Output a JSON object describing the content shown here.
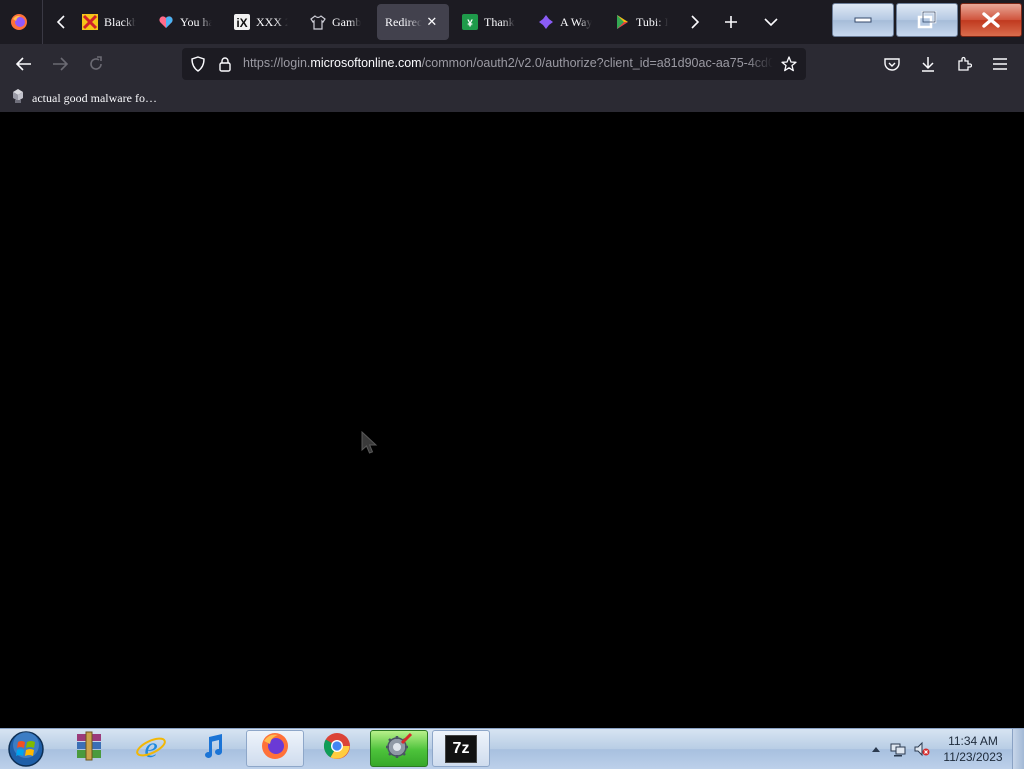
{
  "browser": {
    "tabs": [
      {
        "title": "Blackb",
        "favicon": "x-logo-icon",
        "active": false
      },
      {
        "title": "You ha",
        "favicon": "heart-icon",
        "active": false
      },
      {
        "title": "XXX 2",
        "favicon": "ix-logo-icon",
        "active": false
      },
      {
        "title": "Gamb",
        "favicon": "shirt-icon",
        "active": false
      },
      {
        "title": "Redirec",
        "favicon": "none",
        "active": true
      },
      {
        "title": "Thank",
        "favicon": "green-y-icon",
        "active": false
      },
      {
        "title": "A Way",
        "favicon": "purple-diamond-icon",
        "active": false
      },
      {
        "title": "Tubi: I",
        "favicon": "play-store-icon",
        "active": false
      }
    ],
    "url": {
      "prefix": "https://login.",
      "domain": "microsoftonline.com",
      "path": "/common/oauth2/v2.0/authorize?client_id=a81d90ac-aa75-4cd0"
    },
    "bookmarks": [
      {
        "label": "actual good malware fo…",
        "icon": "bookmark-favicon"
      }
    ]
  },
  "taskbar": {
    "pinned": [
      {
        "name": "winrar-icon",
        "state": "pinned"
      },
      {
        "name": "internet-explorer-icon",
        "state": "pinned"
      },
      {
        "name": "itunes-icon",
        "state": "pinned"
      },
      {
        "name": "firefox-icon",
        "state": "open"
      },
      {
        "name": "chrome-icon",
        "state": "pinned"
      },
      {
        "name": "settings-app-icon",
        "state": "highlight"
      },
      {
        "name": "7zip-icon",
        "state": "open"
      }
    ],
    "clock": {
      "time": "11:34 AM",
      "date": "11/23/2023"
    },
    "seven_zip_label": "7z"
  },
  "colors": {
    "tabstrip_bg": "#1c1b22",
    "toolbar_bg": "#2b2a33",
    "active_tab": "#42414d",
    "page_bg": "#000000",
    "close_button": "#c0391f"
  }
}
